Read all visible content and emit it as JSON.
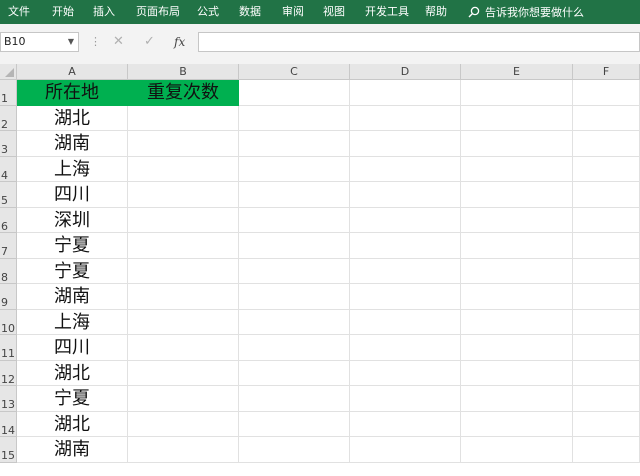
{
  "ribbon": {
    "tabs": [
      "文件",
      "开始",
      "插入",
      "页面布局",
      "公式",
      "数据",
      "审阅",
      "视图",
      "开发工具",
      "帮助"
    ],
    "tell_me": "告诉我你想要做什么"
  },
  "formula_bar": {
    "name_box": "B10",
    "cancel_symbol": "✕",
    "enter_symbol": "✓",
    "fx_symbol": "fx",
    "formula": ""
  },
  "columns": [
    "A",
    "B",
    "C",
    "D",
    "E",
    "F"
  ],
  "rows": [
    "1",
    "2",
    "3",
    "4",
    "5",
    "6",
    "7",
    "8",
    "9",
    "10",
    "11",
    "12",
    "13",
    "14",
    "15"
  ],
  "sheet": {
    "header": [
      "所在地",
      "重复次数"
    ],
    "col_a_values": [
      "湖北",
      "湖南",
      "上海",
      "四川",
      "深圳",
      "宁夏",
      "宁夏",
      "湖南",
      "上海",
      "四川",
      "湖北",
      "宁夏",
      "湖北",
      "湖南"
    ],
    "header_fill": "#00b050"
  },
  "colors": {
    "ribbon": "#217346",
    "header_fill": "#00b050"
  }
}
